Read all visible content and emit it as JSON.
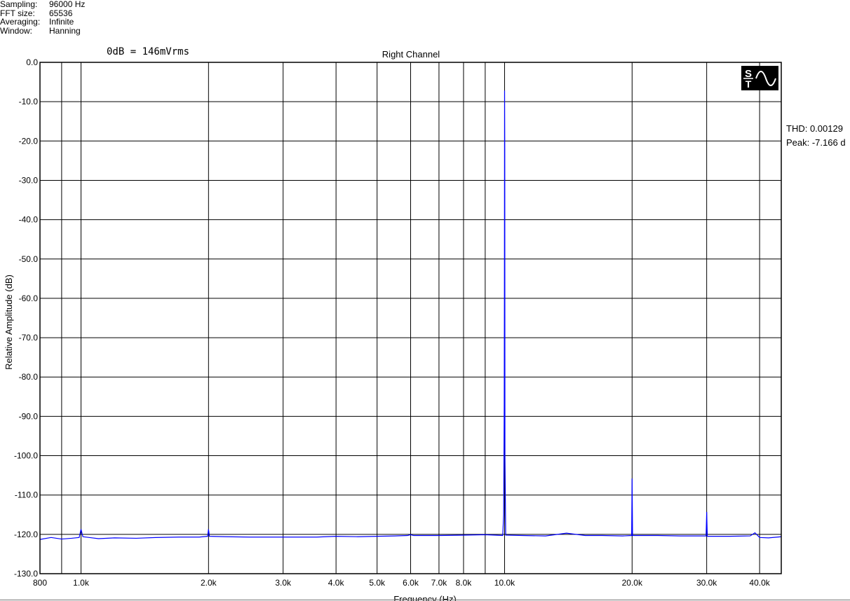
{
  "settings": [
    {
      "label": "Sampling:",
      "value": "96000 Hz"
    },
    {
      "label": "FFT size:",
      "value": "65536"
    },
    {
      "label": "Averaging:",
      "value": "Infinite"
    },
    {
      "label": "Window:",
      "value": "Hanning"
    }
  ],
  "reference": "0dB = 146mVrms",
  "stats": {
    "thd": "THD: 0.00129",
    "peak": "Peak: -7.166 d"
  },
  "logo": {
    "icon": "sine-wave-logo-icon",
    "letters": "ST"
  },
  "chart_data": {
    "type": "line",
    "title": "Right Channel",
    "xlabel": "Frequency (Hz)",
    "ylabel": "Relative Amplitude (dB)",
    "xscale": "log",
    "xlim": [
      800,
      45000
    ],
    "ylim": [
      -130,
      0
    ],
    "xticks": [
      {
        "v": 800,
        "label": "800"
      },
      {
        "v": 1000,
        "label": "1.0k"
      },
      {
        "v": 2000,
        "label": "2.0k"
      },
      {
        "v": 3000,
        "label": "3.0k"
      },
      {
        "v": 4000,
        "label": "4.0k"
      },
      {
        "v": 5000,
        "label": "5.0k"
      },
      {
        "v": 6000,
        "label": "6.0k"
      },
      {
        "v": 7000,
        "label": "7.0k"
      },
      {
        "v": 8000,
        "label": "8.0k"
      },
      {
        "v": 10000,
        "label": "10.0k"
      },
      {
        "v": 20000,
        "label": "20.0k"
      },
      {
        "v": 30000,
        "label": "30.0k"
      },
      {
        "v": 40000,
        "label": "40.0k"
      }
    ],
    "xgrid_extra": [
      900,
      9000
    ],
    "yticks": [
      {
        "v": 0,
        "label": "0.0"
      },
      {
        "v": -10,
        "label": "-10.0"
      },
      {
        "v": -20,
        "label": "-20.0"
      },
      {
        "v": -30,
        "label": "-30.0"
      },
      {
        "v": -40,
        "label": "-40.0"
      },
      {
        "v": -50,
        "label": "-50.0"
      },
      {
        "v": -60,
        "label": "-60.0"
      },
      {
        "v": -70,
        "label": "-70.0"
      },
      {
        "v": -80,
        "label": "-80.0"
      },
      {
        "v": -90,
        "label": "-90.0"
      },
      {
        "v": -100,
        "label": "-100.0"
      },
      {
        "v": -110,
        "label": "-110.0"
      },
      {
        "v": -120,
        "label": "-120.0"
      },
      {
        "v": -130,
        "label": "-130.0"
      }
    ],
    "grid": true,
    "series": [
      {
        "color": "#0000ff",
        "points": [
          [
            800,
            -121.3
          ],
          [
            850,
            -120.8
          ],
          [
            900,
            -121.2
          ],
          [
            950,
            -121.0
          ],
          [
            990,
            -120.8
          ],
          [
            1000,
            -118.7
          ],
          [
            1010,
            -120.6
          ],
          [
            1100,
            -121.1
          ],
          [
            1200,
            -120.9
          ],
          [
            1350,
            -121.0
          ],
          [
            1500,
            -120.8
          ],
          [
            1700,
            -120.7
          ],
          [
            1900,
            -120.7
          ],
          [
            1990,
            -120.5
          ],
          [
            2000,
            -118.7
          ],
          [
            2010,
            -120.5
          ],
          [
            2200,
            -120.6
          ],
          [
            2500,
            -120.7
          ],
          [
            2800,
            -120.7
          ],
          [
            3200,
            -120.7
          ],
          [
            3600,
            -120.7
          ],
          [
            4000,
            -120.5
          ],
          [
            4500,
            -120.6
          ],
          [
            5000,
            -120.5
          ],
          [
            5500,
            -120.4
          ],
          [
            5900,
            -120.3
          ],
          [
            6000,
            -120.1
          ],
          [
            6100,
            -120.3
          ],
          [
            7000,
            -120.3
          ],
          [
            8000,
            -120.2
          ],
          [
            9000,
            -120.1
          ],
          [
            9900,
            -120.3
          ],
          [
            9950,
            -115.0
          ],
          [
            9980,
            -87.0
          ],
          [
            9990,
            -60.0
          ],
          [
            10000,
            -7.166
          ],
          [
            10010,
            -22.0
          ],
          [
            10020,
            -100.0
          ],
          [
            10060,
            -120.2
          ],
          [
            11000,
            -120.3
          ],
          [
            12500,
            -120.4
          ],
          [
            14000,
            -119.7
          ],
          [
            15500,
            -120.3
          ],
          [
            17000,
            -120.3
          ],
          [
            19000,
            -120.4
          ],
          [
            19950,
            -120.3
          ],
          [
            20000,
            -105.8
          ],
          [
            20050,
            -120.3
          ],
          [
            23000,
            -120.3
          ],
          [
            26000,
            -120.4
          ],
          [
            29900,
            -120.4
          ],
          [
            30000,
            -114.3
          ],
          [
            30100,
            -120.5
          ],
          [
            34000,
            -120.5
          ],
          [
            38000,
            -120.4
          ],
          [
            39000,
            -119.6
          ],
          [
            40000,
            -120.8
          ],
          [
            42000,
            -120.9
          ],
          [
            45000,
            -120.6
          ]
        ]
      }
    ]
  }
}
